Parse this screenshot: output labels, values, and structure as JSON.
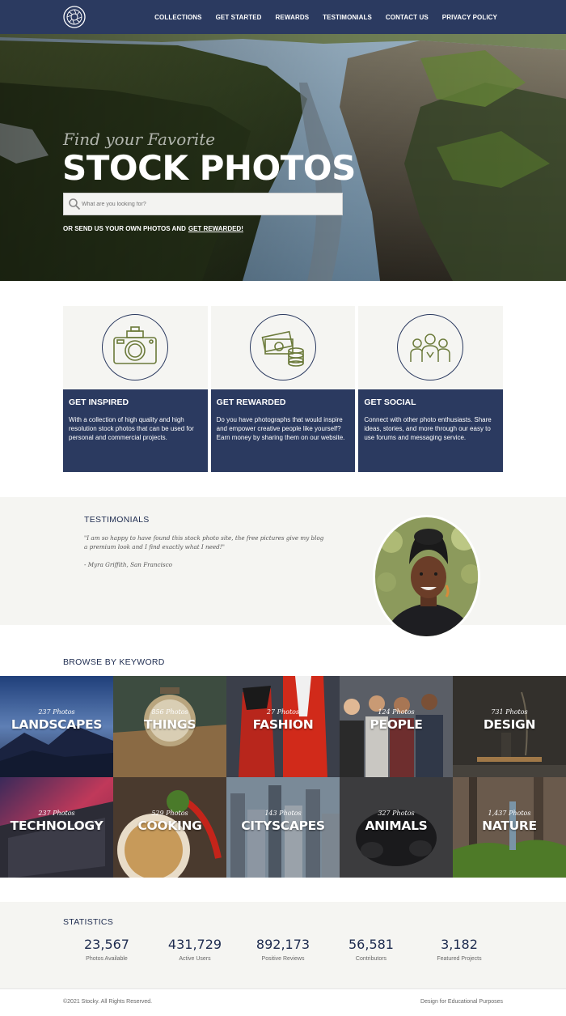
{
  "nav": {
    "logo_icon": "camera-aperture-logo-icon",
    "links": [
      "COLLECTIONS",
      "GET STARTED",
      "REWARDS",
      "TESTIMONIALS",
      "CONTACT US",
      "PRIVACY POLICY"
    ]
  },
  "hero": {
    "tagline": "Find your Favorite",
    "title": "STOCK PHOTOS",
    "search_placeholder": "What are you looking for?",
    "cta_text": "OR SEND US YOUR OWN PHOTOS AND",
    "cta_link": "GET REWARDED!"
  },
  "features": [
    {
      "icon": "camera-icon",
      "title": "GET INSPIRED",
      "text": "With a collection of high quality and high resolution stock photos that can be used for personal and commercial projects."
    },
    {
      "icon": "money-coins-icon",
      "title": "GET REWARDED",
      "text": "Do you have photographs that would inspire and empower creative people like yourself? Earn money by sharing them on our website."
    },
    {
      "icon": "people-group-icon",
      "title": "GET SOCIAL",
      "text": "Connect with other photo enthusiasts. Share ideas, stories, and more through our easy to use forums and messaging service."
    }
  ],
  "testimonials": {
    "heading": "TESTIMONIALS",
    "quote": "\"I am so happy to have found this stock photo site, the free pictures give my blog a premium look and I find exactly what I need!\"",
    "author": "- Myra Griffith, San Francisco"
  },
  "browse": {
    "heading": "BROWSE BY KEYWORD",
    "tiles": [
      {
        "count": "237 Photos",
        "keyword": "LANDSCAPES"
      },
      {
        "count": "856 Photos",
        "keyword": "THINGS"
      },
      {
        "count": "27 Photos",
        "keyword": "FASHION"
      },
      {
        "count": "124 Photos",
        "keyword": "PEOPLE"
      },
      {
        "count": "731 Photos",
        "keyword": "DESIGN"
      },
      {
        "count": "237 Photos",
        "keyword": "TECHNOLOGY"
      },
      {
        "count": "529 Photos",
        "keyword": "COOKING"
      },
      {
        "count": "143 Photos",
        "keyword": "CITYSCAPES"
      },
      {
        "count": "327 Photos",
        "keyword": "ANIMALS"
      },
      {
        "count": "1,437 Photos",
        "keyword": "NATURE"
      }
    ]
  },
  "statistics": {
    "heading": "STATISTICS",
    "items": [
      {
        "value": "23,567",
        "label": "Photos Available"
      },
      {
        "value": "431,729",
        "label": "Active Users"
      },
      {
        "value": "892,173",
        "label": "Positive Reviews"
      },
      {
        "value": "56,581",
        "label": "Contributors"
      },
      {
        "value": "3,182",
        "label": "Featured Projects"
      }
    ]
  },
  "footer": {
    "copyright": "©2021 Stocky. All Rights Reserved.",
    "credit": "Design for Educational Purposes"
  },
  "colors": {
    "navy": "#2b3a60",
    "light_bg": "#f5f5f2",
    "icon_olive": "#6b7a3a"
  }
}
